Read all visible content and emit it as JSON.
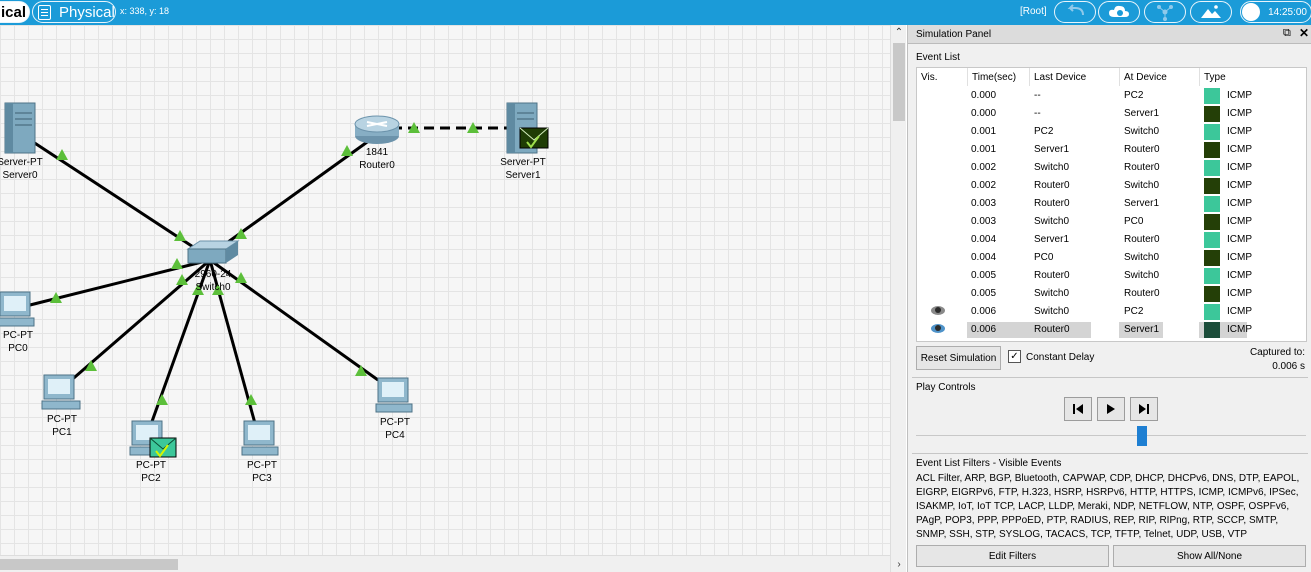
{
  "topbar": {
    "logical_tab": "ical",
    "physical_tab": "Physical",
    "coords": "x: 338, y: 18",
    "root": "[Root]",
    "time": "14:25:00"
  },
  "topology": {
    "devices": [
      {
        "id": "server0",
        "model": "Server-PT",
        "name": "Server0"
      },
      {
        "id": "router0",
        "model": "1841",
        "name": "Router0"
      },
      {
        "id": "server1",
        "model": "Server-PT",
        "name": "Server1"
      },
      {
        "id": "switch0",
        "model": "2960-24",
        "name": "Switch0"
      },
      {
        "id": "pc0",
        "model": "PC-PT",
        "name": "PC0"
      },
      {
        "id": "pc1",
        "model": "PC-PT",
        "name": "PC1"
      },
      {
        "id": "pc2",
        "model": "PC-PT",
        "name": "PC2"
      },
      {
        "id": "pc3",
        "model": "PC-PT",
        "name": "PC3"
      },
      {
        "id": "pc4",
        "model": "PC-PT",
        "name": "PC4"
      }
    ]
  },
  "simulation_panel": {
    "title": "Simulation Panel",
    "event_list_label": "Event List",
    "columns": [
      "Vis.",
      "Time(sec)",
      "Last Device",
      "At Device",
      "Type"
    ],
    "events": [
      {
        "vis": "",
        "time": "0.000",
        "last": "--",
        "at": "PC2",
        "color": "#3cc79a",
        "type": "ICMP"
      },
      {
        "vis": "",
        "time": "0.000",
        "last": "--",
        "at": "Server1",
        "color": "#243f07",
        "type": "ICMP"
      },
      {
        "vis": "",
        "time": "0.001",
        "last": "PC2",
        "at": "Switch0",
        "color": "#3cc79a",
        "type": "ICMP"
      },
      {
        "vis": "",
        "time": "0.001",
        "last": "Server1",
        "at": "Router0",
        "color": "#243f07",
        "type": "ICMP"
      },
      {
        "vis": "",
        "time": "0.002",
        "last": "Switch0",
        "at": "Router0",
        "color": "#3cc79a",
        "type": "ICMP"
      },
      {
        "vis": "",
        "time": "0.002",
        "last": "Router0",
        "at": "Switch0",
        "color": "#243f07",
        "type": "ICMP"
      },
      {
        "vis": "",
        "time": "0.003",
        "last": "Router0",
        "at": "Server1",
        "color": "#3cc79a",
        "type": "ICMP"
      },
      {
        "vis": "",
        "time": "0.003",
        "last": "Switch0",
        "at": "PC0",
        "color": "#243f07",
        "type": "ICMP"
      },
      {
        "vis": "",
        "time": "0.004",
        "last": "Server1",
        "at": "Router0",
        "color": "#3cc79a",
        "type": "ICMP"
      },
      {
        "vis": "",
        "time": "0.004",
        "last": "PC0",
        "at": "Switch0",
        "color": "#243f07",
        "type": "ICMP"
      },
      {
        "vis": "",
        "time": "0.005",
        "last": "Router0",
        "at": "Switch0",
        "color": "#3cc79a",
        "type": "ICMP"
      },
      {
        "vis": "",
        "time": "0.005",
        "last": "Switch0",
        "at": "Router0",
        "color": "#243f07",
        "type": "ICMP"
      },
      {
        "vis": "eye-icon",
        "time": "0.006",
        "last": "Switch0",
        "at": "PC2",
        "color": "#3cc79a",
        "type": "ICMP"
      },
      {
        "vis": "eye-icon",
        "time": "0.006",
        "last": "Router0",
        "at": "Server1",
        "color": "#1c4d3a",
        "type": "ICMP",
        "selected": true
      }
    ],
    "reset_button": "Reset Simulation",
    "constant_delay_label": "Constant Delay",
    "constant_delay_checked": true,
    "captured_to_label": "Captured to:",
    "captured_to_value": "0.006 s",
    "play_controls_label": "Play Controls",
    "filters_label": "Event List Filters - Visible Events",
    "filters_text": "ACL Filter, ARP, BGP, Bluetooth, CAPWAP, CDP, DHCP, DHCPv6, DNS, DTP, EAPOL, EIGRP, EIGRPv6, FTP, H.323, HSRP, HSRPv6, HTTP, HTTPS, ICMP, ICMPv6, IPSec, ISAKMP, IoT, IoT TCP, LACP, LLDP, Meraki, NDP, NETFLOW, NTP, OSPF, OSPFv6, PAgP, POP3, PPP, PPPoED, PTP, RADIUS, REP, RIP, RIPng, RTP, SCCP, SMTP, SNMP, SSH, STP, SYSLOG, TACACS, TCP, TFTP, Telnet, UDP, USB, VTP",
    "edit_filters_button": "Edit Filters",
    "show_all_button": "Show All/None"
  }
}
